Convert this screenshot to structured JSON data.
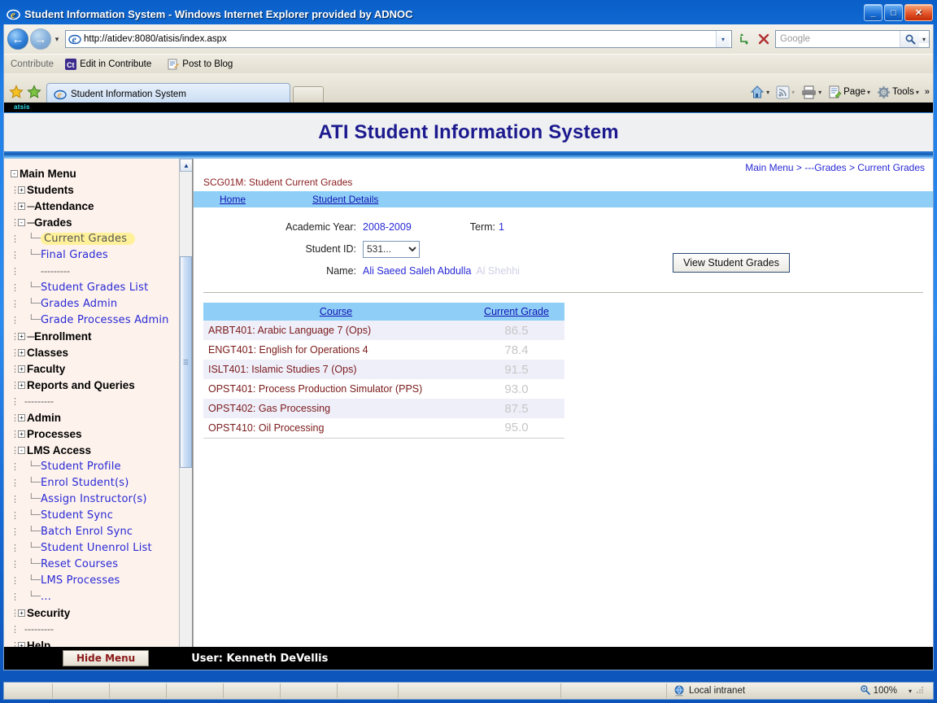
{
  "window": {
    "title": "Student Information System - Windows Internet Explorer provided by ADNOC",
    "icon": "ie-logo-icon",
    "minimize_label": "_",
    "maximize_label": "□",
    "close_label": "✕"
  },
  "navbar": {
    "back_label": "←",
    "forward_label": "→",
    "history_caret": "▾",
    "address_value": "http://atidev:8080/atisis/index.aspx",
    "address_dropdown_caret": "▾",
    "refresh_label": "↻",
    "stop_label": "✕",
    "search_placeholder": "Google",
    "search_value": "",
    "search_go_label": "🔍",
    "search_dropdown_caret": "▾"
  },
  "contribute_bar": {
    "title": "Contribute",
    "items": [
      {
        "label": "Edit in Contribute",
        "icon": "contribute-icon"
      },
      {
        "label": "Post to Blog",
        "icon": "post-to-blog-icon"
      }
    ]
  },
  "tabbar": {
    "favorites_star": "★",
    "add_favorites_star": "★",
    "tabs": [
      {
        "label": "Student Information System",
        "icon": "ie-favicon"
      }
    ],
    "new_tab_label": "",
    "right_buttons": [
      {
        "label": "",
        "icon": "home-icon",
        "caret": "▾"
      },
      {
        "label": "",
        "icon": "feeds-icon",
        "caret": "▾"
      },
      {
        "label": "",
        "icon": "print-icon",
        "caret": "▾"
      },
      {
        "label": "Page",
        "icon": "page-icon",
        "caret": "▾"
      },
      {
        "label": "Tools",
        "icon": "gear-icon",
        "caret": "▾"
      }
    ],
    "overflow_label": "»"
  },
  "app": {
    "atsis_label": "atsis",
    "banner_title": "ATI Student Information System"
  },
  "sidebar": {
    "nodes": [
      {
        "id": "main-menu",
        "label": "Main Menu",
        "type": "root",
        "toggle": "-",
        "depth": 0
      },
      {
        "id": "students",
        "label": "Students",
        "type": "branch",
        "toggle": "+",
        "depth": 1,
        "dashes": ""
      },
      {
        "id": "attendance",
        "label": "Attendance",
        "type": "branch",
        "toggle": "+",
        "depth": 1,
        "dashes": "---"
      },
      {
        "id": "grades",
        "label": "Grades",
        "type": "branch",
        "toggle": "-",
        "depth": 1,
        "dashes": "---"
      },
      {
        "id": "current-grades",
        "label": "Current Grades",
        "type": "leaf-selected",
        "depth": 2
      },
      {
        "id": "final-grades",
        "label": "Final Grades",
        "type": "leaf",
        "depth": 2
      },
      {
        "id": "sep1",
        "label": "---------",
        "type": "separator",
        "depth": 2
      },
      {
        "id": "student-grades-list",
        "label": "Student Grades List",
        "type": "leaf",
        "depth": 2
      },
      {
        "id": "grades-admin",
        "label": "Grades Admin",
        "type": "leaf",
        "depth": 2
      },
      {
        "id": "grade-processes-admin",
        "label": "Grade Processes Admin",
        "type": "leaf",
        "depth": 2
      },
      {
        "id": "enrollment",
        "label": "Enrollment",
        "type": "branch",
        "toggle": "+",
        "depth": 1,
        "dashes": "---"
      },
      {
        "id": "classes",
        "label": "Classes",
        "type": "branch",
        "toggle": "+",
        "depth": 1,
        "dashes": ""
      },
      {
        "id": "faculty",
        "label": "Faculty",
        "type": "branch",
        "toggle": "+",
        "depth": 1,
        "dashes": ""
      },
      {
        "id": "reports-and-queries",
        "label": "Reports and Queries",
        "type": "branch",
        "toggle": "+",
        "depth": 1,
        "dashes": ""
      },
      {
        "id": "sep2",
        "label": "---------",
        "type": "separator",
        "depth": 1
      },
      {
        "id": "admin",
        "label": "Admin",
        "type": "branch",
        "toggle": "+",
        "depth": 1,
        "dashes": ""
      },
      {
        "id": "processes",
        "label": "Processes",
        "type": "branch",
        "toggle": "+",
        "depth": 1,
        "dashes": ""
      },
      {
        "id": "lms-access",
        "label": "LMS Access",
        "type": "branch",
        "toggle": "-",
        "depth": 1,
        "dashes": ""
      },
      {
        "id": "student-profile",
        "label": "Student Profile",
        "type": "leaf",
        "depth": 2
      },
      {
        "id": "enrol-students",
        "label": "Enrol Student(s)",
        "type": "leaf",
        "depth": 2
      },
      {
        "id": "assign-instructors",
        "label": "Assign Instructor(s)",
        "type": "leaf",
        "depth": 2
      },
      {
        "id": "student-sync",
        "label": "Student Sync",
        "type": "leaf",
        "depth": 2
      },
      {
        "id": "batch-enrol-sync",
        "label": "Batch Enrol Sync",
        "type": "leaf",
        "depth": 2
      },
      {
        "id": "student-unenrol-list",
        "label": "Student Unenrol List",
        "type": "leaf",
        "depth": 2
      },
      {
        "id": "reset-courses",
        "label": "Reset Courses",
        "type": "leaf",
        "depth": 2
      },
      {
        "id": "lms-processes",
        "label": "LMS Processes",
        "type": "leaf",
        "depth": 2
      },
      {
        "id": "lms-more",
        "label": "...",
        "type": "leaf-plain",
        "depth": 2
      },
      {
        "id": "security",
        "label": "Security",
        "type": "branch",
        "toggle": "+",
        "depth": 1,
        "dashes": ""
      },
      {
        "id": "sep3",
        "label": "---------",
        "type": "separator",
        "depth": 1
      },
      {
        "id": "help",
        "label": "Help",
        "type": "branch",
        "toggle": "+",
        "depth": 1,
        "dashes": ""
      },
      {
        "id": "sep4",
        "label": "---------",
        "type": "separator",
        "depth": 1
      }
    ],
    "scroll_up": "▲",
    "scroll_down": "▼"
  },
  "content": {
    "breadcrumb": "Main Menu > ---Grades > Current Grades",
    "form_code": "SCG01M: Student Current Grades",
    "subtabs": [
      {
        "id": "home",
        "label": "Home"
      },
      {
        "id": "student-details",
        "label": "Student Details"
      }
    ],
    "fields": {
      "academic_year_label": "Academic Year:",
      "academic_year_value": "2008-2009",
      "term_label": "Term:",
      "term_value": "1",
      "student_id_label": "Student ID:",
      "student_id_value": "531...",
      "student_id_options": [
        "531..."
      ],
      "name_label": "Name:",
      "name_value": "Ali Saeed Saleh Abdulla",
      "name_value_redacted": "Al Shehhi"
    },
    "view_button_label": "View Student Grades",
    "table": {
      "columns": [
        "Course",
        "Current Grade"
      ],
      "rows": [
        {
          "course": "ARBT401: Arabic Language 7 (Ops)",
          "grade": "86.5"
        },
        {
          "course": "ENGT401: English for Operations 4",
          "grade": "78.4"
        },
        {
          "course": "ISLT401: Islamic Studies 7 (Ops)",
          "grade": "91.5"
        },
        {
          "course": "OPST401: Process Production Simulator (PPS)",
          "grade": "93.0"
        },
        {
          "course": "OPST402: Gas Processing",
          "grade": "87.5"
        },
        {
          "course": "OPST410: Oil Processing",
          "grade": "95.0"
        }
      ]
    },
    "hscroll_left": "‹",
    "hscroll_right": "›"
  },
  "footer": {
    "hide_menu_label": "Hide Menu",
    "user_label": "User: Kenneth DeVellis"
  },
  "statusbar": {
    "zone_label": "Local intranet",
    "zone_icon": "globe-icon",
    "zoom_label": "100%",
    "zoom_icon": "magnifier-plus-icon",
    "zoom_caret": "▾"
  },
  "colors": {
    "titlebar_blue": "#1F7FE8",
    "banner_title": "#1C1A8E",
    "link_blue": "#2929D6",
    "table_header": "#8FCFF7",
    "sidebar_bg": "#FDF2EC",
    "highlight_yellow": "#FFF19A",
    "course_text": "#7A1A1A",
    "grade_text": "#C6C6C6"
  }
}
